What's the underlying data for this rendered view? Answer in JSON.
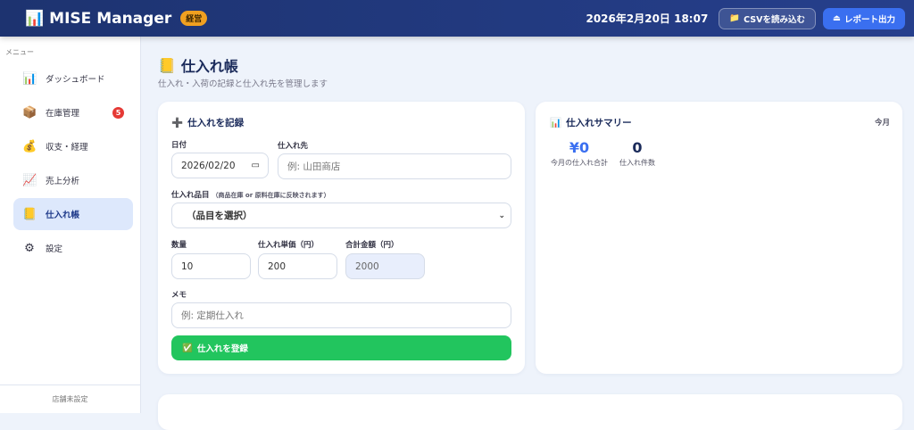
{
  "header": {
    "app_name": "MISE Manager",
    "role_badge": "経営",
    "datetime": "2026年2月20日 18:07",
    "csv_button": "CSVを読み込む",
    "report_button": "レポート出力"
  },
  "sidebar": {
    "menu_label": "メニュー",
    "items": [
      {
        "label": "ダッシュボード",
        "icon": "📊"
      },
      {
        "label": "在庫管理",
        "icon": "📦",
        "badge": "5"
      },
      {
        "label": "収支・経理",
        "icon": "💰"
      },
      {
        "label": "売上分析",
        "icon": "📈"
      },
      {
        "label": "仕入れ帳",
        "icon": "📒"
      },
      {
        "label": "設定",
        "icon": "⚙"
      }
    ],
    "footer": "店舗未設定"
  },
  "page": {
    "title": "仕入れ帳",
    "subtitle": "仕入れ・入荷の記録と仕入れ先を管理します"
  },
  "form": {
    "title": "仕入れを記録",
    "date_label": "日付",
    "date_value": "2026/02/20",
    "supplier_label": "仕入れ先",
    "supplier_placeholder": "例: 山田商店",
    "item_label": "仕入れ品目",
    "item_note": "（商品在庫 or 原料在庫に反映されます）",
    "item_value": "（品目を選択）",
    "qty_label": "数量",
    "qty_value": "10",
    "price_label": "仕入れ単価（円）",
    "price_value": "200",
    "total_label": "合計金額（円）",
    "total_value": "2000",
    "memo_label": "メモ",
    "memo_placeholder": "例: 定期仕入れ",
    "submit": "仕入れを登録"
  },
  "summary": {
    "title": "仕入れサマリー",
    "period": "今月",
    "total_value": "¥0",
    "total_label": "今月の仕入れ合計",
    "count_value": "0",
    "count_label": "仕入れ件数"
  }
}
